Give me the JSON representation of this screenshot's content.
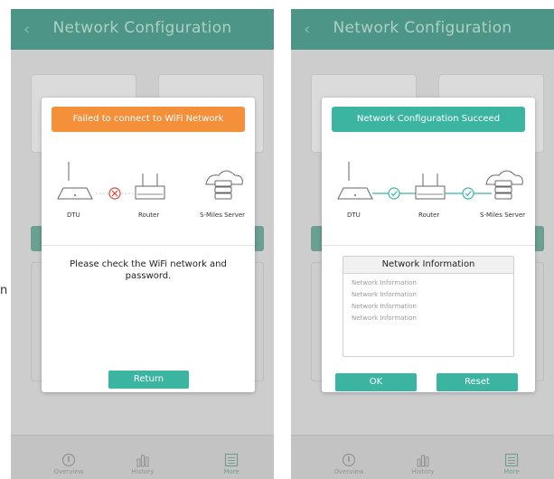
{
  "edge_text": "n",
  "screens": [
    {
      "header_title": "Network Configuration",
      "banner": "Failed to connect to WiFi Network",
      "nodes": [
        "DTU",
        "Router",
        "S-Miles Server"
      ],
      "message": "Please check the WiFi network and password.",
      "button": "Return",
      "tabs": [
        "Overview",
        "History",
        "More"
      ]
    },
    {
      "header_title": "Network Configuration",
      "banner": "Network Configuration Succeed",
      "nodes": [
        "DTU",
        "Router",
        "S-Miles Server"
      ],
      "info_title": "Network Information",
      "info_lines": [
        "Network Information",
        "Network Information",
        "Network Information",
        "Network Information"
      ],
      "ok_button": "OK",
      "reset_button": "Reset",
      "tabs": [
        "Overview",
        "History",
        "More"
      ]
    }
  ],
  "colors": {
    "header": "#4f9d8d",
    "fail_banner": "#f48f3a",
    "success": "#3bb5a2",
    "error_icon": "#e0473f"
  },
  "icons": {
    "back": "chevron-left-icon",
    "dtu": "dtu-device-icon",
    "router": "router-icon",
    "server": "cloud-server-icon",
    "fail": "error-x-icon",
    "ok": "check-circle-icon",
    "overview": "overview-icon",
    "history": "bar-chart-icon",
    "more": "list-icon"
  }
}
